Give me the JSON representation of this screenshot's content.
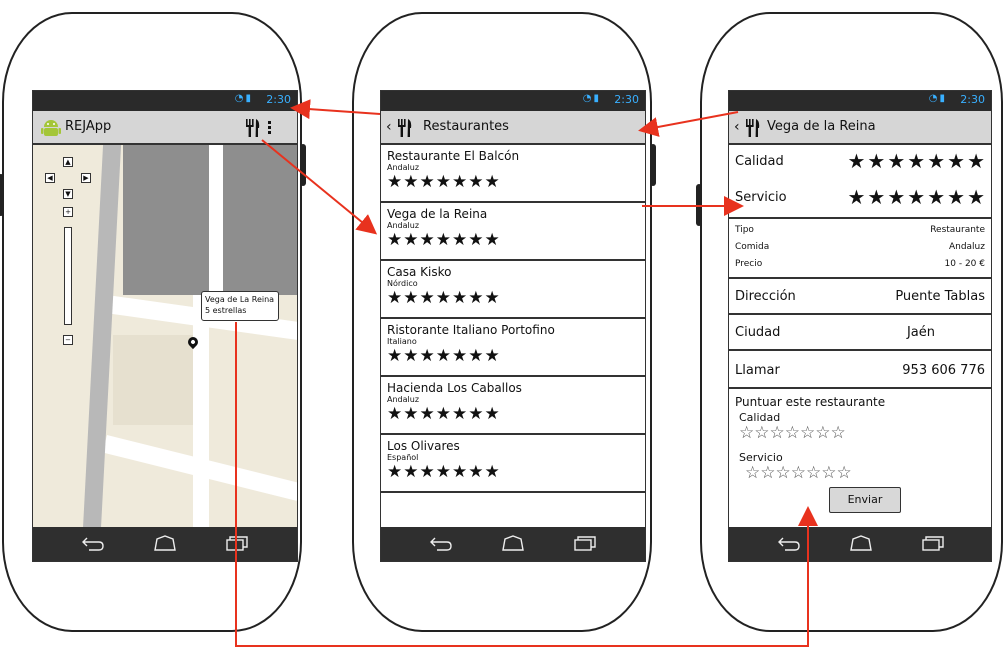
{
  "status": {
    "time": "2:30"
  },
  "screen1": {
    "app_title": "REJApp",
    "bubble_line1": "Vega de La Reina",
    "bubble_line2": "5 estrellas"
  },
  "screen2": {
    "title": "Restaurantes",
    "items": [
      {
        "name": "Restaurante El Balcón",
        "cuisine": "Andaluz",
        "stars": "★★★★★★★"
      },
      {
        "name": "Vega de la Reina",
        "cuisine": "Andaluz",
        "stars": "★★★★★★★"
      },
      {
        "name": "Casa Kisko",
        "cuisine": "Nórdico",
        "stars": "★★★★★★★"
      },
      {
        "name": "Ristorante Italiano Portofino",
        "cuisine": "Italiano",
        "stars": "★★★★★★★"
      },
      {
        "name": "Hacienda Los Caballos",
        "cuisine": "Andaluz",
        "stars": "★★★★★★★"
      },
      {
        "name": "Los Olivares",
        "cuisine": "Español",
        "stars": "★★★★★★★"
      }
    ]
  },
  "screen3": {
    "title": "Vega de la Reina",
    "ratings": [
      {
        "label": "Calidad",
        "stars": "★★★★★★★"
      },
      {
        "label": "Servicio",
        "stars": "★★★★★★★"
      }
    ],
    "info": [
      {
        "label": "Tipo",
        "value": "Restaurante"
      },
      {
        "label": "Comida",
        "value": "Andaluz"
      },
      {
        "label": "Precio",
        "value": "10 - 20 €"
      }
    ],
    "details": [
      {
        "label": "Dirección",
        "value": "Puente Tablas"
      },
      {
        "label": "Ciudad",
        "value": "Jaén"
      },
      {
        "label": "Llamar",
        "value": "953 606 776"
      }
    ],
    "rate_heading": "Puntuar este restaurante",
    "rate_quality_label": "Calidad",
    "rate_service_label": "Servicio",
    "empty_stars": "☆☆☆☆☆☆☆",
    "send_label": "Enviar"
  },
  "colors": {
    "arrow": "#e8321e",
    "accent": "#39b0ff",
    "android": "#a4c639"
  },
  "icons": [
    "android-icon",
    "restaurant-icon",
    "overflow-menu-icon",
    "back-icon",
    "home-icon",
    "recent-apps-icon",
    "map-pin-icon",
    "wifi-icon",
    "signal-icon",
    "battery-icon"
  ]
}
